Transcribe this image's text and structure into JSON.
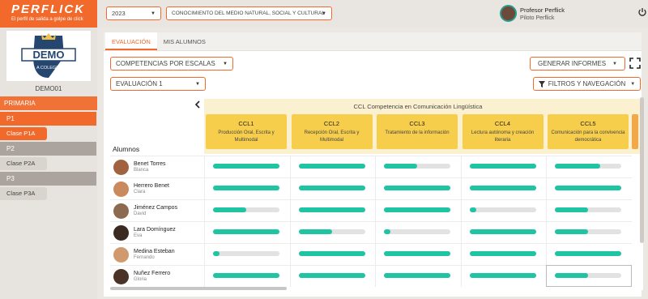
{
  "app": {
    "logo": "PERFLICK",
    "tagline": "El perfil de salida a golpe de click"
  },
  "sidebar": {
    "emblem_text": "DEMO",
    "emblem_sub": "A COLEGIO",
    "school_code": "DEMO01",
    "stage": "PRIMARIA",
    "groups": [
      {
        "label": "P1",
        "classes": [
          "Clase P1A"
        ]
      },
      {
        "label": "P2",
        "classes": [
          "Clase P2A"
        ]
      },
      {
        "label": "P3",
        "classes": [
          "Clase P3A"
        ]
      }
    ]
  },
  "topbar": {
    "year": "2023",
    "subject": "CONOCIMIENTO DEL MEDIO NATURAL, SOCIAL Y CULTURAL",
    "user_name": "Profesor Perflick",
    "user_role": "Piloto Perflick",
    "power_icon": "power-icon"
  },
  "tabs": [
    "EVALUACIÓN",
    "MIS ALUMNOS"
  ],
  "controls": {
    "view_select": "COMPETENCIAS POR ESCALAS",
    "evaluation_select": "EVALUACIÓN 1",
    "reports_button": "GENERAR INFORMES",
    "filters_button": "FILTROS Y NAVEGACIÓN",
    "back_icon": "chevron-left-icon",
    "expand_icon": "fullscreen-icon",
    "filter_icon": "filter-icon"
  },
  "table": {
    "students_header": "Alumnos",
    "competence_title": "CCL Competencia en Comunicación Lingüística",
    "colors": {
      "card": "#f7ce4c",
      "bar": "#1fc4a2",
      "accent": "#f2692c"
    },
    "competences": [
      {
        "code": "CCL1",
        "desc": "Producción Oral, Escrita y Multimodal"
      },
      {
        "code": "CCL2",
        "desc": "Recepción Oral, Escrita y Multimodal"
      },
      {
        "code": "CCL3",
        "desc": "Tratamiento de la información"
      },
      {
        "code": "CCL4",
        "desc": "Lectura autónoma y creación literaria"
      },
      {
        "code": "CCL5",
        "desc": "Comunicación para la convivencia democrática"
      }
    ],
    "students": [
      {
        "name": "Benet Torres",
        "first": "Blanca",
        "progress": [
          1.0,
          1.0,
          0.5,
          1.0,
          0.68
        ]
      },
      {
        "name": "Herrero Benet",
        "first": "Clara",
        "progress": [
          1.0,
          1.0,
          1.0,
          1.0,
          1.0
        ]
      },
      {
        "name": "Jiménez Campos",
        "first": "David",
        "progress": [
          0.5,
          1.0,
          1.0,
          0.1,
          0.5
        ]
      },
      {
        "name": "Lara Domínguez",
        "first": "Eva",
        "progress": [
          1.0,
          0.5,
          0.1,
          1.0,
          0.5
        ]
      },
      {
        "name": "Medina Esteban",
        "first": "Fernando",
        "progress": [
          0.1,
          1.0,
          1.0,
          1.0,
          1.0
        ]
      },
      {
        "name": "Nuñez Ferrero",
        "first": "Gloria",
        "progress": [
          1.0,
          1.0,
          1.0,
          1.0,
          0.5
        ]
      }
    ]
  }
}
